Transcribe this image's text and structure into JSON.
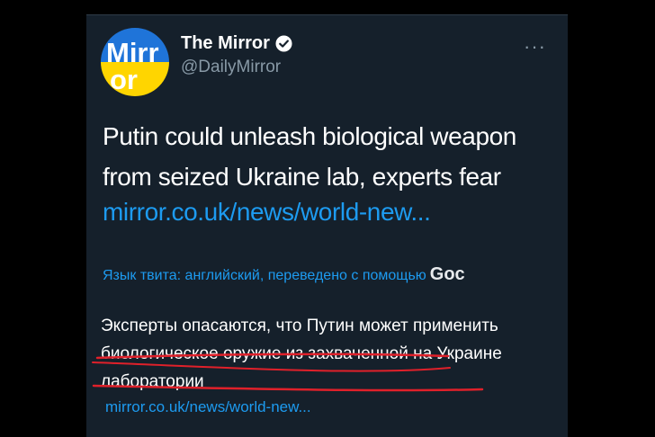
{
  "tweet": {
    "display_name": "The Mirror",
    "handle": "@DailyMirror",
    "avatar_text": "Mirror",
    "more_label": "···",
    "text": "Putin could unleash biological weapon from seized Ukraine lab, experts fear",
    "link": "mirror.co.uk/news/world-new...",
    "translation_note": "Язык твита: английский, переведено с помощью",
    "translation_provider": "Goc",
    "translated_text": "Эксперты опасаются, что Путин может применить биологическое оружие из захваченной на Украине лаборатории",
    "translated_link": "mirror.co.uk/news/world-new..."
  },
  "colors": {
    "background": "#15202b",
    "link": "#1d9bf0",
    "annotation": "#e0202a",
    "avatar_top": "#1f74d9",
    "avatar_bottom": "#ffd500"
  },
  "icons": [
    "verified-badge-icon",
    "more-options-icon"
  ]
}
